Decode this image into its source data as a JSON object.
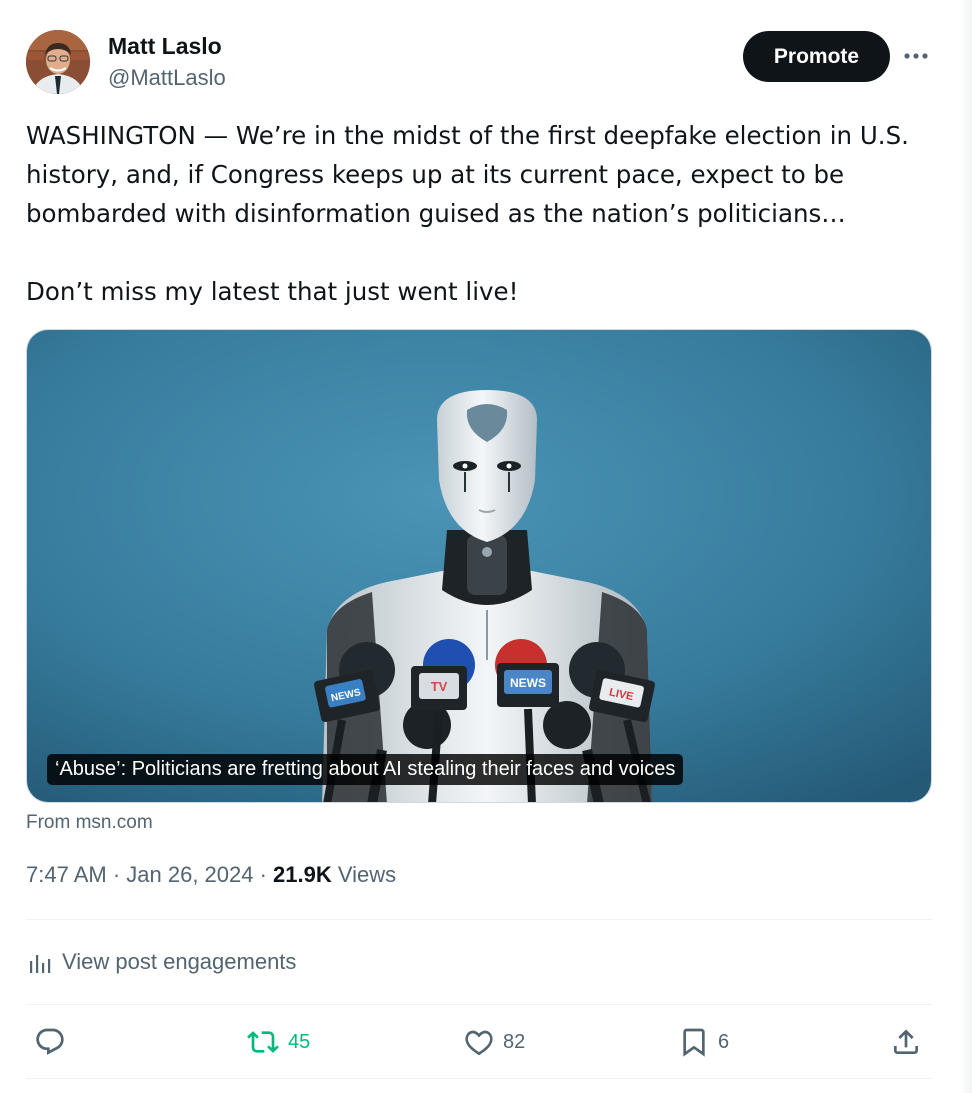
{
  "author": {
    "name": "Matt Laslo",
    "handle": "@MattLaslo"
  },
  "header": {
    "promote_label": "Promote",
    "more_icon": "more-horizontal-icon"
  },
  "post": {
    "paragraph_1": "WASHINGTON — We’re in the midst of the first deepfake election in U.S. history, and, if Congress keeps up at its current pace, expect to be bombarded with disinformation guised as the nation’s politicians…",
    "paragraph_2": "Don’t miss my latest that just went live!"
  },
  "card": {
    "caption": "‘Abuse’: Politicians are fretting about AI stealing their faces and voices",
    "source": "From msn.com",
    "mic_labels": [
      "NEWS",
      "TV",
      "NEWS",
      "LIVE"
    ]
  },
  "meta": {
    "time_date": "7:47 AM · Jan 26, 2024 · ",
    "views_count": "21.9K",
    "views_label": " Views"
  },
  "engagements_label": "View post engagements",
  "actions": {
    "reply": {
      "icon": "reply-icon",
      "count": ""
    },
    "retweet": {
      "icon": "retweet-icon",
      "count": "45",
      "active_color": "#00ba7c"
    },
    "like": {
      "icon": "heart-icon",
      "count": "82"
    },
    "bookmark": {
      "icon": "bookmark-icon",
      "count": "6"
    },
    "share": {
      "icon": "share-icon"
    }
  },
  "colors": {
    "text": "#0f1419",
    "secondary": "#536471",
    "retweet": "#00ba7c",
    "card_background": "#3a7fa1"
  }
}
